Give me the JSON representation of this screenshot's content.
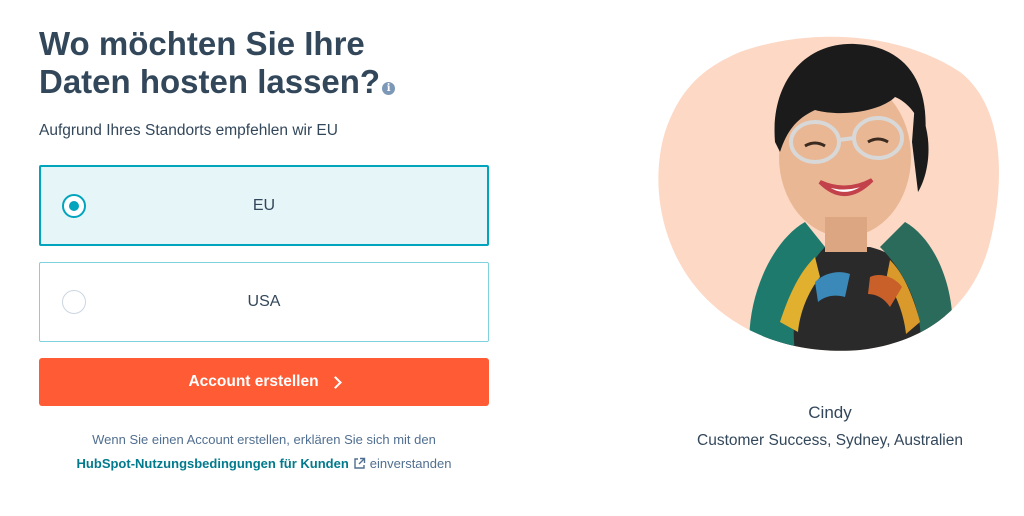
{
  "heading": {
    "title": "Wo möchten Sie Ihre Daten hosten lassen?",
    "info_icon": "info-icon"
  },
  "subtitle": "Aufgrund Ihres Standorts empfehlen wir EU",
  "options": [
    {
      "label": "EU",
      "selected": true
    },
    {
      "label": "USA",
      "selected": false
    }
  ],
  "cta": {
    "label": "Account erstellen",
    "icon": "chevron-right-icon"
  },
  "legal": {
    "text_before": "Wenn Sie einen Account erstellen, erklären Sie sich mit den",
    "link": "HubSpot-Nutzungsbedingungen für Kunden",
    "link_icon": "external-link-icon",
    "text_after": "einverstanden"
  },
  "testimonial": {
    "name": "Cindy",
    "role": "Customer Success, Sydney, Australien"
  },
  "colors": {
    "accent": "#00a4bd",
    "cta": "#ff5c35",
    "text": "#33475b",
    "link": "#007a8c",
    "blob": "#fcd8c5"
  }
}
